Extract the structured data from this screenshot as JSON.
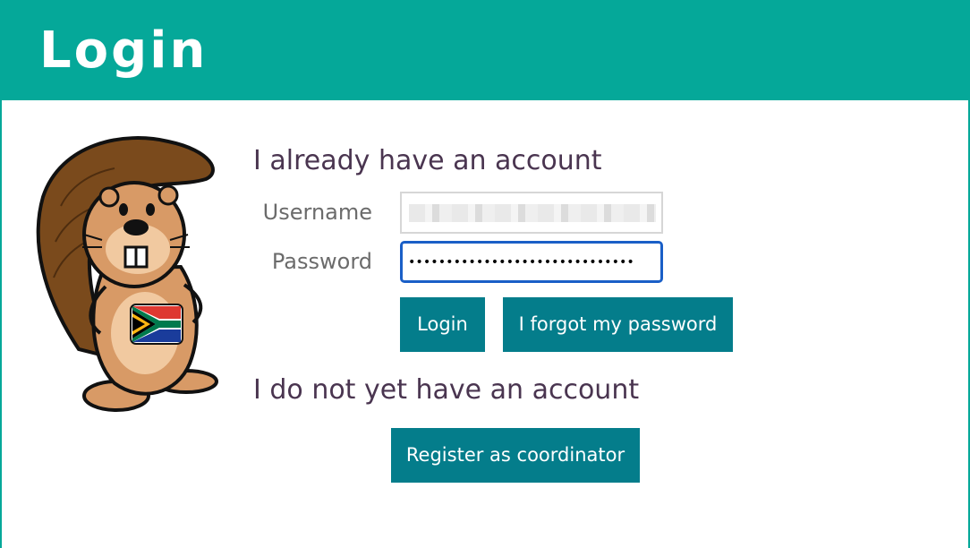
{
  "header": {
    "title": "Login"
  },
  "mascot": {
    "icon": "beaver-mascot-icon",
    "flag": "south-africa-flag-icon"
  },
  "existing_account": {
    "heading": "I already have an account",
    "username_label": "Username",
    "password_label": "Password",
    "password_value": "••••••••••••••••••••••••••••••",
    "login_button": "Login",
    "forgot_button": "I forgot my password"
  },
  "new_account": {
    "heading": "I do not yet have an account",
    "register_button": "Register as coordinator"
  },
  "colors": {
    "header_bg": "#05a899",
    "button_bg": "#047d8b",
    "heading_text": "#4a3550",
    "focus_ring": "#1a5fc7"
  }
}
